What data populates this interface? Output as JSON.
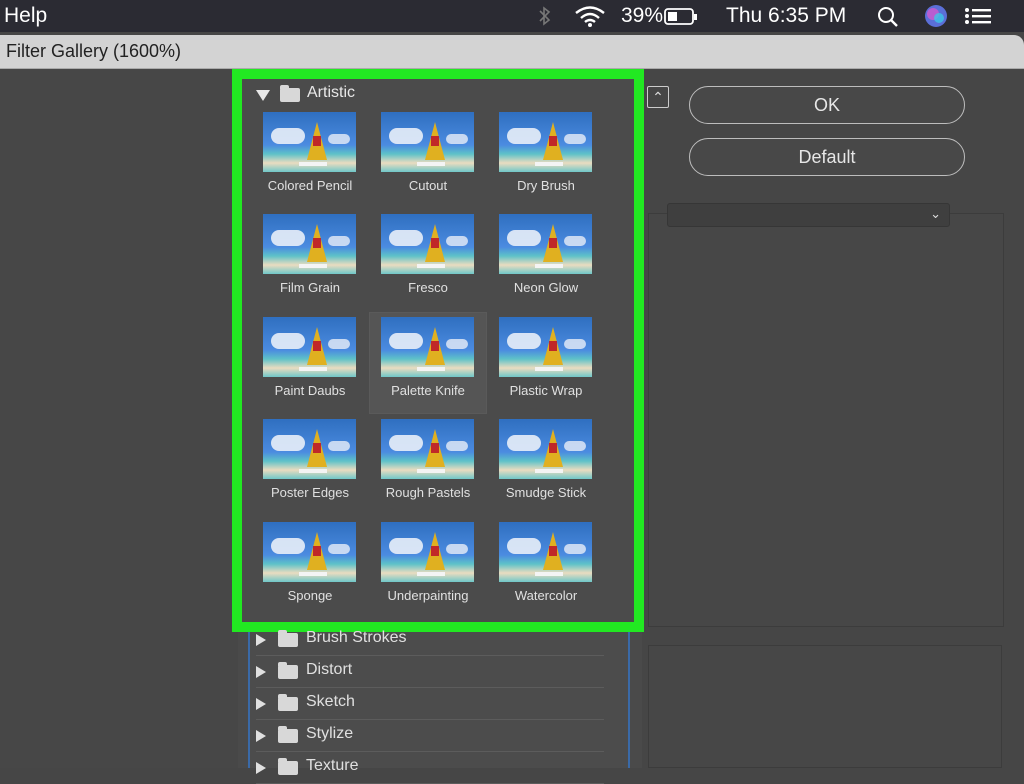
{
  "menubar": {
    "app_menu": "Help",
    "battery": "39%",
    "clock": "Thu 6:35 PM",
    "icons": [
      "bluetooth-icon",
      "wifi-icon",
      "battery-icon",
      "search-icon",
      "siri-icon",
      "notification-center-icon"
    ]
  },
  "window": {
    "title": "Filter Gallery (1600%)"
  },
  "gallery": {
    "open_category": "Artistic",
    "filters": [
      {
        "label": "Colored Pencil"
      },
      {
        "label": "Cutout"
      },
      {
        "label": "Dry Brush"
      },
      {
        "label": "Film Grain"
      },
      {
        "label": "Fresco"
      },
      {
        "label": "Neon Glow"
      },
      {
        "label": "Paint Daubs"
      },
      {
        "label": "Palette Knife"
      },
      {
        "label": "Plastic Wrap"
      },
      {
        "label": "Poster Edges"
      },
      {
        "label": "Rough Pastels"
      },
      {
        "label": "Smudge Stick"
      },
      {
        "label": "Sponge"
      },
      {
        "label": "Underpainting"
      },
      {
        "label": "Watercolor"
      }
    ],
    "selected_filter": "Palette Knife",
    "collapsed_categories": [
      {
        "label": "Brush Strokes"
      },
      {
        "label": "Distort"
      },
      {
        "label": "Sketch"
      },
      {
        "label": "Stylize"
      },
      {
        "label": "Texture"
      }
    ]
  },
  "buttons": {
    "ok": "OK",
    "default": "Default"
  },
  "colors": {
    "highlight": "#22e822",
    "panel": "#464646"
  }
}
